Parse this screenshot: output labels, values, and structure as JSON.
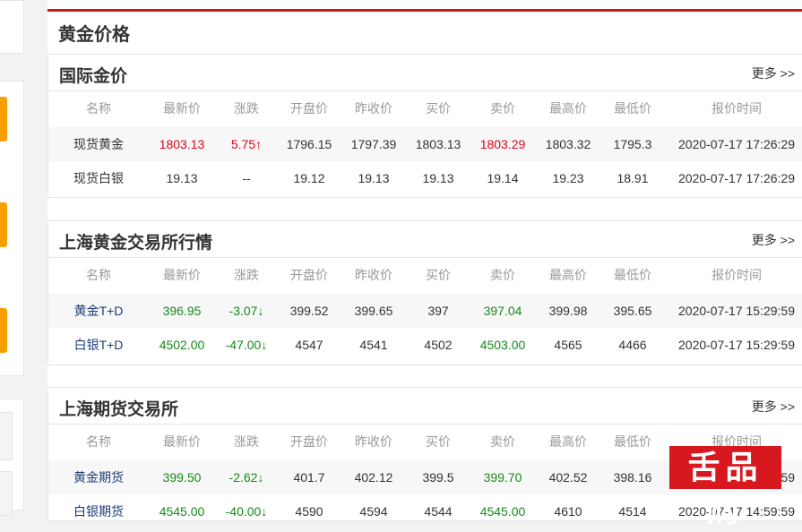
{
  "page_title": "黄金价格",
  "more_label": "更多 >>",
  "columns": [
    "名称",
    "最新价",
    "涨跌",
    "开盘价",
    "昨收价",
    "买价",
    "卖价",
    "最高价",
    "最低价",
    "报价时间"
  ],
  "sections": [
    {
      "title": "国际金价",
      "rows": [
        {
          "name": "现货黄金",
          "latest": "1803.13",
          "change": "5.75↑",
          "open": "1796.15",
          "prev_close": "1797.39",
          "bid": "1803.13",
          "ask": "1803.29",
          "high": "1803.32",
          "low": "1795.3",
          "time": "2020-07-17 17:26:29"
        },
        {
          "name": "现货白银",
          "latest": "19.13",
          "change": "--",
          "open": "19.12",
          "prev_close": "19.13",
          "bid": "19.13",
          "ask": "19.14",
          "high": "19.23",
          "low": "18.91",
          "time": "2020-07-17 17:26:29"
        }
      ]
    },
    {
      "title": "上海黄金交易所行情",
      "rows": [
        {
          "name": "黄金T+D",
          "latest": "396.95",
          "change": "-3.07↓",
          "open": "399.52",
          "prev_close": "399.65",
          "bid": "397",
          "ask": "397.04",
          "high": "399.98",
          "low": "395.65",
          "time": "2020-07-17 15:29:59"
        },
        {
          "name": "白银T+D",
          "latest": "4502.00",
          "change": "-47.00↓",
          "open": "4547",
          "prev_close": "4541",
          "bid": "4502",
          "ask": "4503.00",
          "high": "4565",
          "low": "4466",
          "time": "2020-07-17 15:29:59"
        }
      ]
    },
    {
      "title": "上海期货交易所",
      "rows": [
        {
          "name": "黄金期货",
          "latest": "399.50",
          "change": "-2.62↓",
          "open": "401.7",
          "prev_close": "402.12",
          "bid": "399.5",
          "ask": "399.70",
          "high": "402.52",
          "low": "398.16",
          "time": "2020-07-17 14:59:59"
        },
        {
          "name": "白银期货",
          "latest": "4545.00",
          "change": "-40.00↓",
          "open": "4590",
          "prev_close": "4594",
          "bid": "4544",
          "ask": "4545.00",
          "high": "4610",
          "low": "4514",
          "time": "2020-07-17 14:59:59"
        }
      ]
    }
  ],
  "watermark_text": "舌品购",
  "colors": {
    "accent_red": "#c4161c",
    "price_red": "#e2001a",
    "price_green": "#15891a",
    "orange": "#f5a000"
  }
}
